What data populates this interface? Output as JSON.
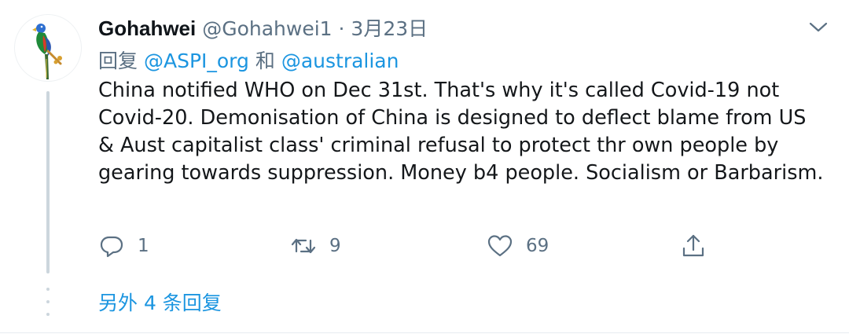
{
  "tweet": {
    "display_name": "Gohahwei",
    "handle": "@Gohahwei1",
    "separator": "·",
    "date": "3月23日",
    "reply_prefix": "回复",
    "reply_to_1": "@ASPI_org",
    "reply_conjunction": "和",
    "reply_to_2": "@australian",
    "text": "China notified WHO on Dec 31st. That's why it's called Covid-19 not Covid-20. Demonisation of China is designed to deflect blame from US & Aust capitalist class' criminal refusal to protect thr own people by gearing towards suppression. Money b4 people. Socialism or Barbarism.",
    "avatar_icon": "parrot-avatar-icon"
  },
  "actions": {
    "reply_icon": "reply-icon",
    "reply_count": "1",
    "retweet_icon": "retweet-icon",
    "retweet_count": "9",
    "like_icon": "heart-icon",
    "like_count": "69",
    "share_icon": "share-icon"
  },
  "more_replies": "另外 4 条回复",
  "colors": {
    "accent": "#1b95e0",
    "secondary_text": "#5b7083",
    "primary_text": "#14171a",
    "thread_line": "#ccd6dd"
  }
}
